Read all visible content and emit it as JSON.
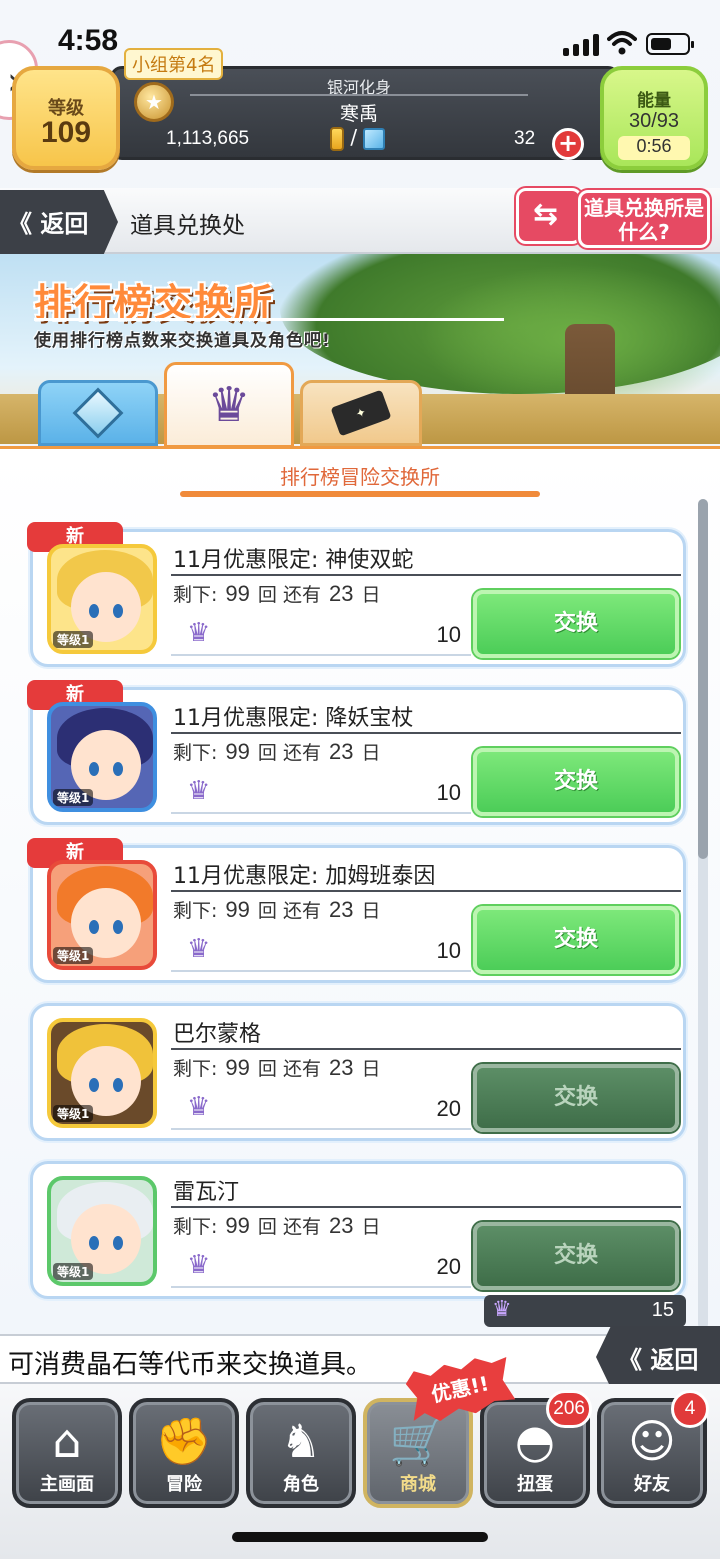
{
  "status_bar": {
    "time": "4:58"
  },
  "header": {
    "level_label": "等级",
    "level_value": "109",
    "rank_tag": "小组第4名",
    "player_title": "银河化身",
    "player_name": "寒禹",
    "coins": "1,113,665",
    "currency_separator": "/",
    "crystals": "32",
    "energy_label": "能量",
    "energy_value": "30/93",
    "energy_timer": "0:56"
  },
  "nav": {
    "back_label": "《 返回",
    "title": "道具兑换处",
    "help_label": "道具兑换所是什么?"
  },
  "banner": {
    "title": "排行榜交换所",
    "subtitle": "使用排行榜点数来交换道具及角色吧!"
  },
  "tabs": [
    {
      "icon": "crystal-cube-icon",
      "active": false
    },
    {
      "icon": "crown-icon",
      "active": true
    },
    {
      "icon": "ticket-icon",
      "active": false
    }
  ],
  "section": {
    "title": "排行榜冒险交换所"
  },
  "items": [
    {
      "is_new": true,
      "new_label": "新",
      "name": "11月优惠限定: 神使双蛇",
      "remain_label": "剩下:",
      "remain": "99",
      "remain_unit": "回",
      "days_label": "还有",
      "days": "23",
      "days_unit": "日",
      "cost": "10",
      "button": "交换",
      "enabled": true,
      "level": "等级1",
      "frame_color": "#f5c93b",
      "bg_color": "#fde48a",
      "hair_color": "#f2c84a"
    },
    {
      "is_new": true,
      "new_label": "新",
      "name": "11月优惠限定: 降妖宝杖",
      "remain_label": "剩下:",
      "remain": "99",
      "remain_unit": "回",
      "days_label": "还有",
      "days": "23",
      "days_unit": "日",
      "cost": "10",
      "button": "交换",
      "enabled": true,
      "level": "等级1",
      "frame_color": "#3f8fe0",
      "bg_color": "#5566b5",
      "hair_color": "#2c2f74"
    },
    {
      "is_new": true,
      "new_label": "新",
      "name": "11月优惠限定: 加姆班泰因",
      "remain_label": "剩下:",
      "remain": "99",
      "remain_unit": "回",
      "days_label": "还有",
      "days": "23",
      "days_unit": "日",
      "cost": "10",
      "button": "交换",
      "enabled": true,
      "level": "等级1",
      "frame_color": "#e84a3a",
      "bg_color": "#f6a07a",
      "hair_color": "#f27a2a"
    },
    {
      "is_new": false,
      "new_label": "",
      "name": "巴尔蒙格",
      "remain_label": "剩下:",
      "remain": "99",
      "remain_unit": "回",
      "days_label": "还有",
      "days": "23",
      "days_unit": "日",
      "cost": "20",
      "button": "交换",
      "enabled": false,
      "level": "等级1",
      "frame_color": "#f5c93b",
      "bg_color": "#6a4a2a",
      "hair_color": "#f0c23a"
    },
    {
      "is_new": false,
      "new_label": "",
      "name": "雷瓦汀",
      "remain_label": "剩下:",
      "remain": "99",
      "remain_unit": "回",
      "days_label": "还有",
      "days": "23",
      "days_unit": "日",
      "cost": "20",
      "button": "交换",
      "enabled": false,
      "level": "等级1",
      "frame_color": "#5cc86a",
      "bg_color": "#cfe9d8",
      "hair_color": "#e9eef2"
    }
  ],
  "balance": {
    "value": "15"
  },
  "footer_message": "可消费晶石等代币来交换道具。",
  "footer_back": "《 返回",
  "bottom_nav": [
    {
      "label": "主画面",
      "icon": "house-icon",
      "glyph": "⌂",
      "badge": ""
    },
    {
      "label": "冒险",
      "icon": "handshake-icon",
      "glyph": "✊",
      "badge": ""
    },
    {
      "label": "角色",
      "icon": "character-icon",
      "glyph": "♞",
      "badge": ""
    },
    {
      "label": "商城",
      "icon": "cart-icon",
      "glyph": "🛒",
      "badge": "",
      "active": true
    },
    {
      "label": "扭蛋",
      "icon": "egg-icon",
      "glyph": "◓",
      "badge": "206"
    },
    {
      "label": "好友",
      "icon": "friends-icon",
      "glyph": "☺",
      "badge": "4"
    }
  ],
  "sale_tag": "优惠!!"
}
